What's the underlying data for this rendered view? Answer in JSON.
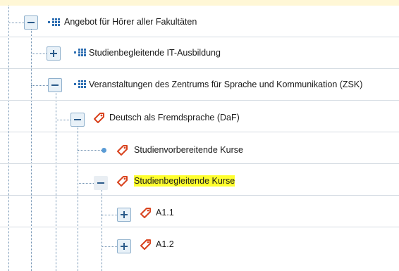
{
  "tree": {
    "nodes": [
      {
        "label": "Angebot für Hörer aller Fakultäten",
        "toggle": "minus",
        "icon": "organization-icon",
        "highlighted": false
      },
      {
        "label": "Studienbegleitende IT-Ausbildung",
        "toggle": "plus",
        "icon": "organization-icon",
        "highlighted": false
      },
      {
        "label": "Veranstaltungen des Zentrums für Sprache und Kommunikation (ZSK)",
        "toggle": "minus",
        "icon": "organization-icon",
        "highlighted": false
      },
      {
        "label": "Deutsch als Fremdsprache (DaF)",
        "toggle": "minus",
        "icon": "tag-icon",
        "highlighted": false
      },
      {
        "label": "Studienvorbereitende Kurse",
        "toggle": "leaf",
        "icon": "tag-icon",
        "highlighted": false
      },
      {
        "label": "Studienbegleitende Kurse",
        "toggle": "minus",
        "icon": "tag-icon",
        "highlighted": true
      },
      {
        "label": "A1.1",
        "toggle": "plus",
        "icon": "tag-icon",
        "highlighted": false
      },
      {
        "label": "A1.2",
        "toggle": "plus",
        "icon": "tag-icon",
        "highlighted": false
      }
    ]
  },
  "colors": {
    "accent": "#2a5a8a",
    "org_icon": "#2f6fb2",
    "tag_icon": "#d9431e",
    "highlight": "#ffff2e",
    "leaf_dot": "#5a9bd5"
  }
}
